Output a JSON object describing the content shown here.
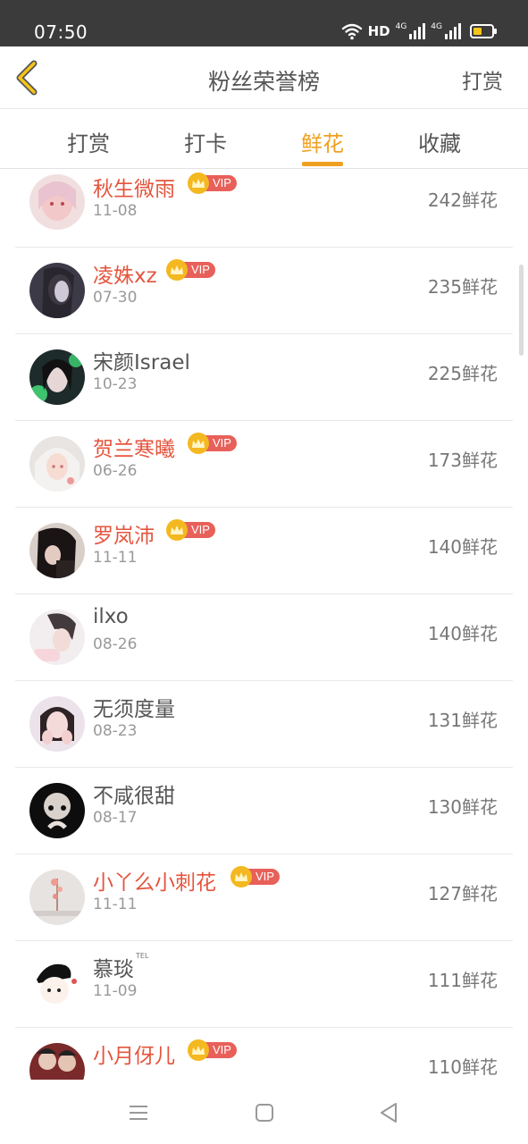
{
  "status_bar": {
    "time": "07:50",
    "hd": "HD",
    "net1": "4G",
    "net2": "4G"
  },
  "header": {
    "title": "粉丝荣誉榜",
    "right_action": "打赏"
  },
  "tabs": [
    {
      "label": "打赏",
      "active": false
    },
    {
      "label": "打卡",
      "active": false
    },
    {
      "label": "鲜花",
      "active": true
    },
    {
      "label": "收藏",
      "active": false
    }
  ],
  "vip_label": "VIP",
  "colors": {
    "accent": "#f0a020",
    "vip_name": "#e4553e",
    "vip_tag": "#e8605a",
    "crown": "#f4b820"
  },
  "fans": [
    {
      "name": "秋生微雨",
      "date": "11-08",
      "count": "242鲜花",
      "vip": true
    },
    {
      "name": "凌姝xz",
      "date": "07-30",
      "count": "235鲜花",
      "vip": true
    },
    {
      "name": "宋颜Israel",
      "date": "10-23",
      "count": "225鲜花",
      "vip": false
    },
    {
      "name": "贺兰寒曦",
      "date": "06-26",
      "count": "173鲜花",
      "vip": true
    },
    {
      "name": "罗岚沛",
      "date": "11-11",
      "count": "140鲜花",
      "vip": true
    },
    {
      "name": "ilxo",
      "date": "08-26",
      "count": "140鲜花",
      "vip": false
    },
    {
      "name": "无须度量",
      "date": "08-23",
      "count": "131鲜花",
      "vip": false
    },
    {
      "name": "不咸很甜",
      "date": "08-17",
      "count": "130鲜花",
      "vip": false
    },
    {
      "name": "小丫么小刺花",
      "date": "11-11",
      "count": "127鲜花",
      "vip": true
    },
    {
      "name": "慕琰",
      "name_sup": "TEL",
      "date": "11-09",
      "count": "111鲜花",
      "vip": false
    },
    {
      "name": "小月伢儿",
      "date": "",
      "count": "110鲜花",
      "vip": true
    }
  ]
}
